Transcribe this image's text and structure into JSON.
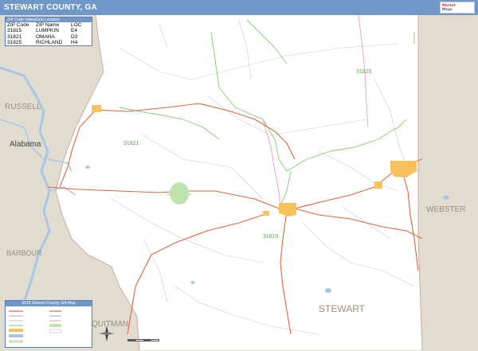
{
  "header": {
    "title": "STEWART COUNTY, GA",
    "logo_line1": "Market",
    "logo_line2": "Maps"
  },
  "zip_index": {
    "heading": "ZIP Code Index/Grid Location",
    "columns": [
      "ZIP Code",
      "ZIP Name",
      "LOC"
    ],
    "rows": [
      [
        "31815",
        "LUMPKIN",
        "E4"
      ],
      [
        "31821",
        "OMAHA",
        "D3"
      ],
      [
        "31825",
        "RICHLAND",
        "H4"
      ]
    ]
  },
  "map_labels": {
    "russell": "RUSSELL",
    "alabama": "Alabama",
    "barbour": "BARBOUR",
    "quitman": "QUITMAN",
    "webster": "WEBSTER",
    "stewart": "STEWART",
    "zip_31821": "31821",
    "zip_31825": "31825",
    "zip_31815": "31815"
  },
  "legend": {
    "heading": "2016 Stewart County, GA Map"
  },
  "colors": {
    "title_bar": "#6f98c9",
    "water": "#a9c6e8",
    "outside_county": "#e0dcd0",
    "county_bg": "#ffffff",
    "highway": "#e1673a",
    "zip_boundary": "#7fcf6a",
    "local_road": "#c9c9c9",
    "town_area": "#f7c25c",
    "pink_route": "#e98fc7"
  },
  "icons": {
    "compass": "compass-rose-icon",
    "scale": "scale-bar-icon"
  }
}
